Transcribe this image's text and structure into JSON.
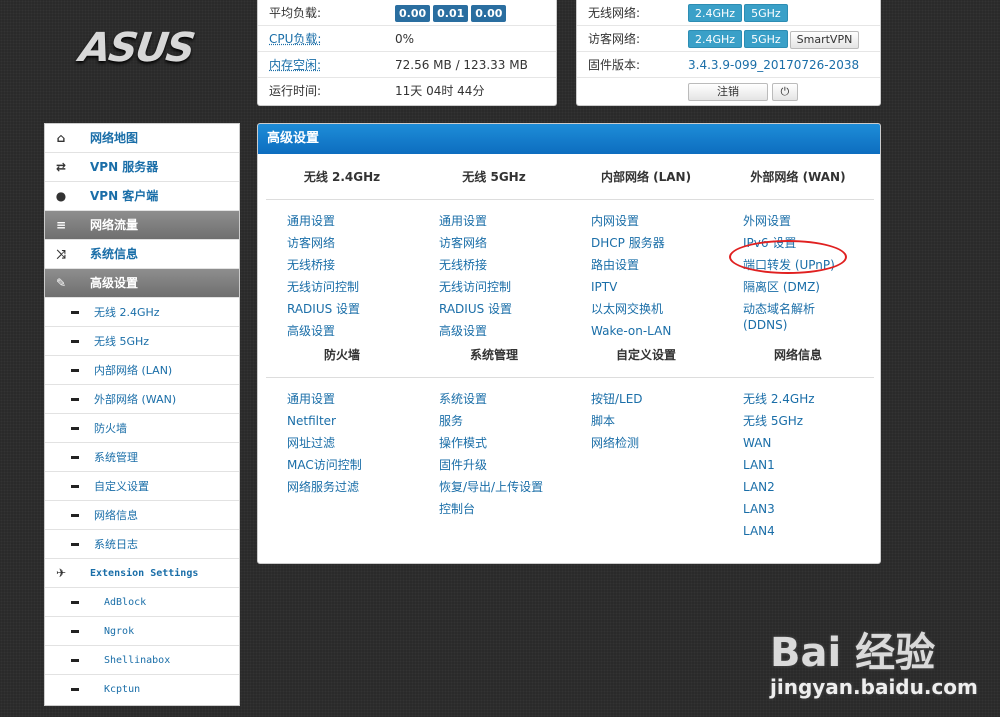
{
  "logo": "ASUS",
  "status": {
    "load_label": "平均负载:",
    "load_values": [
      "0.00",
      "0.01",
      "0.00"
    ],
    "cpu_label": "CPU负载:",
    "cpu_value": "0%",
    "mem_label": "内存空闲:",
    "mem_value": "72.56 MB / 123.33 MB",
    "uptime_label": "运行时间:",
    "uptime_value": "11天 04时 44分"
  },
  "network": {
    "wireless_label": "无线网络:",
    "wireless_buttons": [
      "2.4GHz",
      "5GHz"
    ],
    "guest_label": "访客网络:",
    "guest_buttons": [
      "2.4GHz",
      "5GHz",
      "SmartVPN"
    ],
    "fw_label": "固件版本:",
    "fw_value": "3.4.3.9-099_20170726-2038",
    "logout": "注销",
    "power_icon": "power-icon"
  },
  "sidebar": {
    "items": [
      {
        "label": "网络地图",
        "icon": "home-icon"
      },
      {
        "label": "VPN 服务器",
        "icon": "retweet-icon"
      },
      {
        "label": "VPN 客户端",
        "icon": "globe-icon"
      },
      {
        "label": "网络流量",
        "icon": "list-icon"
      },
      {
        "label": "系统信息",
        "icon": "shuffle-icon"
      },
      {
        "label": "高级设置",
        "icon": "wrench-icon"
      }
    ],
    "subs": [
      "无线 2.4GHz",
      "无线 5GHz",
      "内部网络 (LAN)",
      "外部网络 (WAN)",
      "防火墙",
      "系统管理",
      "自定义设置",
      "网络信息",
      "系统日志"
    ],
    "ext_label": "Extension Settings",
    "ext_subs": [
      "AdBlock",
      "Ngrok",
      "Shellinabox",
      "Kcptun"
    ]
  },
  "main": {
    "title": "高级设置",
    "sections1": [
      {
        "head": "无线 2.4GHz",
        "links": [
          "通用设置",
          "访客网络",
          "无线桥接",
          "无线访问控制",
          "RADIUS 设置",
          "高级设置"
        ]
      },
      {
        "head": "无线 5GHz",
        "links": [
          "通用设置",
          "访客网络",
          "无线桥接",
          "无线访问控制",
          "RADIUS 设置",
          "高级设置"
        ]
      },
      {
        "head": "内部网络 (LAN)",
        "links": [
          "内网设置",
          "DHCP 服务器",
          "路由设置",
          "IPTV",
          "以太网交换机",
          "Wake-on-LAN"
        ]
      },
      {
        "head": "外部网络 (WAN)",
        "links": [
          "外网设置",
          "IPv6 设置",
          "端口转发 (UPnP)",
          "隔离区 (DMZ)",
          "动态域名解析",
          "(DDNS)"
        ]
      }
    ],
    "sections2": [
      {
        "head": "防火墙",
        "links": [
          "通用设置",
          "Netfilter",
          "网址过滤",
          "MAC访问控制",
          "网络服务过滤"
        ]
      },
      {
        "head": "系统管理",
        "links": [
          "系统设置",
          "服务",
          "操作模式",
          "固件升级",
          "恢复/导出/上传设置",
          "控制台"
        ]
      },
      {
        "head": "自定义设置",
        "links": [
          "按钮/LED",
          "脚本",
          "网络检测"
        ]
      },
      {
        "head": "网络信息",
        "links": [
          "无线 2.4GHz",
          "无线 5GHz",
          "WAN",
          "LAN1",
          "LAN2",
          "LAN3",
          "LAN4"
        ]
      }
    ]
  },
  "watermark": {
    "main": "Bai 经验",
    "sub": "jingyan.baidu.com"
  }
}
